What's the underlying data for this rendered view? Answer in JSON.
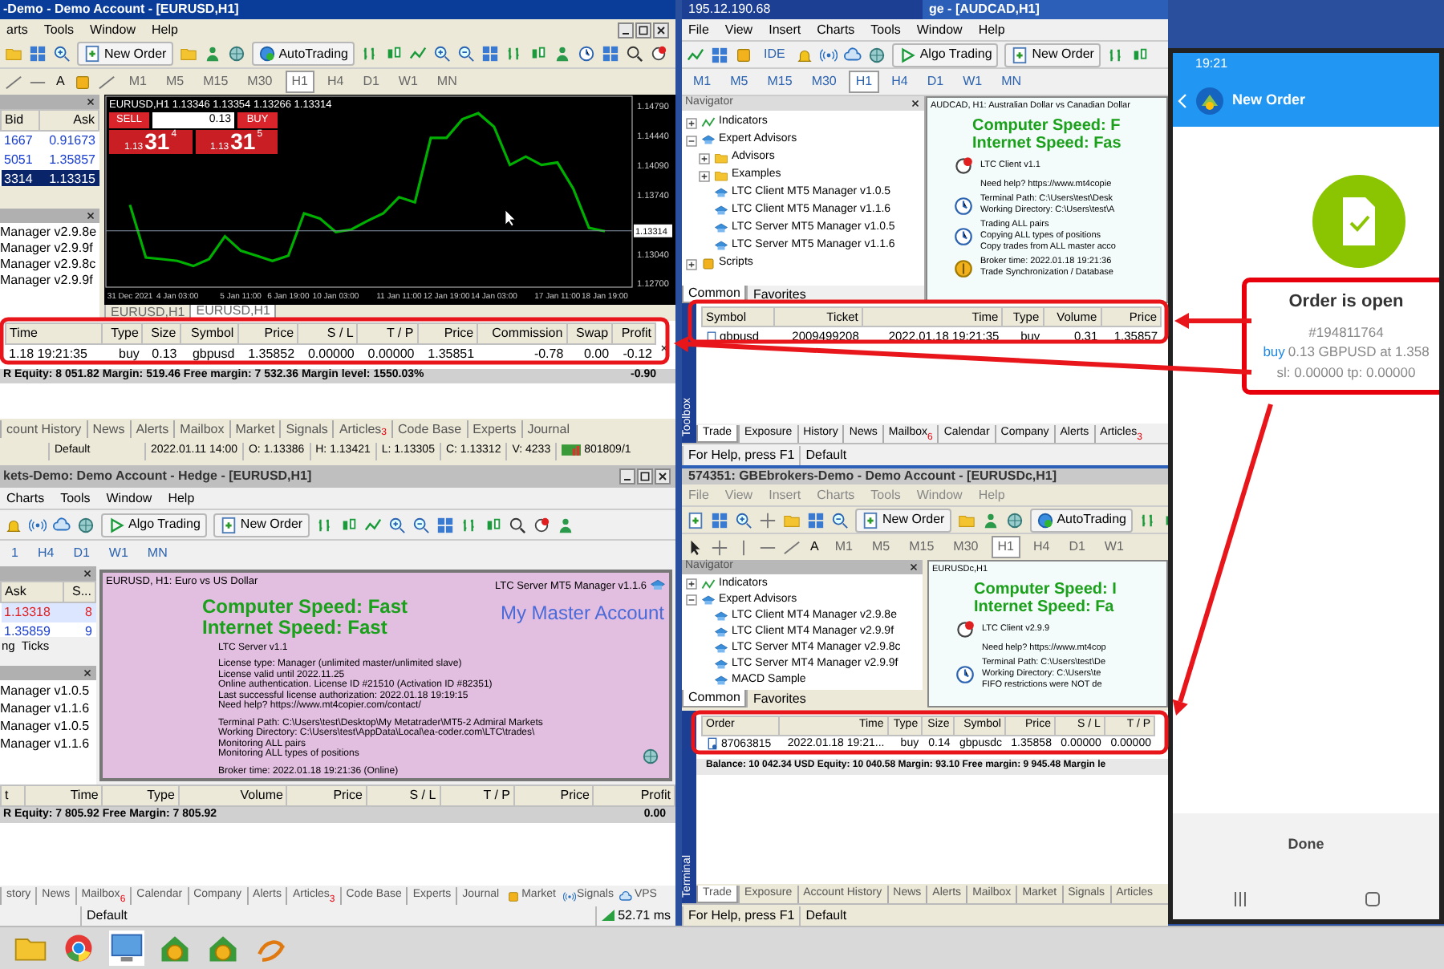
{
  "terminal_top_left": {
    "title": "-Demo - Demo Account - [EURUSD,H1]",
    "menu": [
      "arts",
      "Tools",
      "Window",
      "Help"
    ],
    "toolbar": [
      "New Order",
      "AutoTrading"
    ],
    "drawing_tools": [
      "A"
    ],
    "timeframes": [
      {
        "label": "M1",
        "selected": false
      },
      {
        "label": "M5",
        "selected": false
      },
      {
        "label": "M15",
        "selected": false
      },
      {
        "label": "M30",
        "selected": false
      },
      {
        "label": "H1",
        "selected": true
      },
      {
        "label": "H4",
        "selected": false
      },
      {
        "label": "D1",
        "selected": false
      },
      {
        "label": "W1",
        "selected": false
      },
      {
        "label": "MN",
        "selected": false
      }
    ],
    "market_watch": {
      "columns": [
        "Bid",
        "Ask"
      ],
      "rows": [
        {
          "cells": [
            "1667",
            "0.91673"
          ],
          "selected": false
        },
        {
          "cells": [
            "5051",
            "1.35857"
          ],
          "selected": false
        },
        {
          "cells": [
            "3314",
            "1.13315"
          ],
          "selected": true
        }
      ]
    },
    "navigator": [
      "Manager v2.9.8e",
      "Manager v2.9.9f",
      "Manager v2.9.8c",
      "Manager v2.9.9f"
    ],
    "chart": {
      "header": "EURUSD,H1  1.13346 1.13354 1.13266 1.13314",
      "one_click": {
        "sell_label": "SELL",
        "buy_label": "BUY",
        "lot": "0.13",
        "sell_prefix": "1.13",
        "sell_big": "31",
        "sell_sup": "4",
        "buy_prefix": "1.13",
        "buy_big": "31",
        "buy_sup": "5"
      },
      "current_price": "1.13314",
      "chart_data": {
        "type": "line",
        "categories": [
          "31 Dec 2021",
          null,
          null,
          "4 Jan 03:00",
          null,
          null,
          null,
          "5 Jan 11:00",
          null,
          null,
          "6 Jan 19:00",
          null,
          null,
          "10 Jan 03:00",
          null,
          null,
          null,
          "11 Jan 11:00",
          null,
          null,
          "12 Jan 19:00",
          null,
          null,
          "14 Jan 03:00",
          null,
          null,
          null,
          "17 Jan 11:00",
          null,
          null,
          "18 Jan 19:00"
        ],
        "series": [
          {
            "color": "#00b000",
            "values": [
              1.1362,
              1.13,
              1.1298,
              1.1296,
              1.129,
              1.1298,
              1.1325,
              1.1308,
              1.1302,
              1.1296,
              1.1302,
              1.1352,
              1.1346,
              1.133,
              1.1333,
              1.1343,
              1.1352,
              1.1371,
              1.1365,
              1.1441,
              1.1441,
              1.1463,
              1.147,
              1.1454,
              1.1409,
              1.1419,
              1.1409,
              1.1412,
              1.1381,
              1.1335,
              1.1331
            ]
          }
        ],
        "ylim": [
          1.1265,
          1.149
        ],
        "yticks": [
          {
            "value": 1.127,
            "label": "1.12700"
          },
          {
            "value": 1.1304,
            "label": "1.13040"
          },
          {
            "value": 1.1374,
            "label": "1.13740"
          },
          {
            "value": 1.1409,
            "label": "1.14090"
          },
          {
            "value": 1.1444,
            "label": "1.14440"
          },
          {
            "value": 1.1479,
            "label": "1.14790"
          }
        ]
      }
    },
    "chart_tabs": [
      {
        "label": "EURUSD,H1",
        "selected": false
      },
      {
        "label": "EURUSD,H1",
        "selected": true
      }
    ],
    "trade_table": {
      "columns": [
        "Time",
        "Type",
        "Size",
        "Symbol",
        "Price",
        "S / L",
        "T / P",
        "Price",
        "Commission",
        "Swap",
        "Profit"
      ],
      "rows": [
        [
          "1.18 19:21:35",
          "buy",
          "0.13",
          "gbpusd",
          "1.35852",
          "0.00000",
          "0.00000",
          "1.35851",
          "-0.78",
          "0.00",
          "-0.12"
        ]
      ]
    },
    "summary": {
      "text": "R  Equity: 8 051.82  Margin: 519.46  Free margin: 7 532.36  Margin level: 1550.03%",
      "total": "-0.90"
    },
    "bottom_tabs": [
      {
        "label": "count History",
        "selected": false
      },
      {
        "label": "News",
        "selected": false
      },
      {
        "label": "Alerts",
        "selected": false
      },
      {
        "label": "Mailbox",
        "selected": false
      },
      {
        "label": "Market",
        "selected": false
      },
      {
        "label": "Signals",
        "selected": false
      },
      {
        "label": "Articles",
        "badge": "3",
        "selected": false
      },
      {
        "label": "Code Base",
        "selected": false
      },
      {
        "label": "Experts",
        "selected": false
      },
      {
        "label": "Journal",
        "selected": false
      }
    ],
    "status_bar": [
      "Default",
      "2022.01.11 14:00",
      "O: 1.13386",
      "H: 1.13421",
      "L: 1.13305",
      "C: 1.13312",
      "V: 4233",
      "801809/1"
    ]
  },
  "terminal_top_right": {
    "address": "195.12.190.68",
    "title": "ge - [AUDCAD,H1]",
    "menu": [
      "File",
      "View",
      "Insert",
      "Charts",
      "Tools",
      "Window",
      "Help"
    ],
    "toolbar": [
      "IDE",
      "Algo Trading",
      "New Order"
    ],
    "timeframes": [
      {
        "label": "M1",
        "selected": false
      },
      {
        "label": "M5",
        "selected": false
      },
      {
        "label": "M15",
        "selected": false
      },
      {
        "label": "M30",
        "selected": false
      },
      {
        "label": "H1",
        "selected": true
      },
      {
        "label": "H4",
        "selected": false
      },
      {
        "label": "D1",
        "selected": false
      },
      {
        "label": "W1",
        "selected": false
      },
      {
        "label": "MN",
        "selected": false
      }
    ],
    "navigator": {
      "title": "Navigator",
      "items": [
        {
          "label": "Indicators",
          "kind": "indicators",
          "expanded": false
        },
        {
          "label": "Expert Advisors",
          "kind": "experts",
          "expanded": true,
          "children": [
            {
              "label": "Advisors",
              "kind": "folder",
              "expanded": false
            },
            {
              "label": "Examples",
              "kind": "folder",
              "expanded": false
            },
            {
              "label": "LTC Client MT5 Manager v1.0.5",
              "kind": "expert",
              "expanded": false
            },
            {
              "label": "LTC Client MT5 Manager v1.1.6",
              "kind": "expert",
              "expanded": false
            },
            {
              "label": "LTC Server MT5 Manager v1.0.5",
              "kind": "expert",
              "expanded": false
            },
            {
              "label": "LTC Server MT5 Manager v1.1.6",
              "kind": "expert",
              "expanded": false
            }
          ]
        },
        {
          "label": "Scripts",
          "kind": "scripts",
          "expanded": false
        }
      ],
      "tabs": [
        {
          "label": "Common",
          "selected": true
        },
        {
          "label": "Favorites",
          "selected": false
        }
      ]
    },
    "chart": {
      "header": "AUDCAD, H1:  Australian Dollar vs Canadian Dollar",
      "speed": [
        "Computer Speed: F",
        "Internet Speed: Fas"
      ],
      "blocks": [
        [
          "LTC Client v1.1"
        ],
        [
          "Need help? https://www.mt4copie"
        ],
        [
          "Terminal Path: C:\\Users\\test\\Desk",
          "Working Directory: C:\\Users\\test\\A"
        ],
        [
          "Trading ALL pairs",
          "Copying ALL types of positions",
          "Copy trades from ALL master acco"
        ],
        [
          "Broker time: 2022.01.18 19:21:36",
          "Trade Synchronization / Database"
        ]
      ]
    },
    "side_label": "Toolbox",
    "trade_table": {
      "columns": [
        "Symbol",
        "Ticket",
        "Time",
        "Type",
        "Volume",
        "Price"
      ],
      "rows": [
        [
          "gbpusd",
          "2009499208",
          "2022.01.18 19:21:35",
          "buy",
          "0.31",
          "1.35857"
        ]
      ]
    },
    "bottom_tabs": [
      {
        "label": "Trade",
        "selected": true
      },
      {
        "label": "Exposure",
        "selected": false
      },
      {
        "label": "History",
        "selected": false
      },
      {
        "label": "News",
        "selected": false
      },
      {
        "label": "Mailbox",
        "badge": "6",
        "selected": false
      },
      {
        "label": "Calendar",
        "selected": false
      },
      {
        "label": "Company",
        "selected": false
      },
      {
        "label": "Alerts",
        "selected": false
      },
      {
        "label": "Articles",
        "badge": "3",
        "selected": false
      }
    ],
    "status_bar": [
      "For Help, press F1",
      "Default"
    ]
  },
  "terminal_bottom_left": {
    "title": "kets-Demo: Demo Account - Hedge - [EURUSD,H1]",
    "menu": [
      "Charts",
      "Tools",
      "Window",
      "Help"
    ],
    "toolbar": [
      "Algo Trading",
      "New Order"
    ],
    "timeframes": [
      {
        "label": "1",
        "selected": false
      },
      {
        "label": "H4",
        "selected": false
      },
      {
        "label": "D1",
        "selected": false
      },
      {
        "label": "W1",
        "selected": false
      },
      {
        "label": "MN",
        "selected": false
      }
    ],
    "market_watch": {
      "columns": [
        "Ask",
        "S..."
      ],
      "rows": [
        {
          "cells": [
            "1.13318",
            "8"
          ],
          "selected": true
        },
        {
          "cells": [
            "1.35859",
            "9"
          ],
          "selected": false
        }
      ],
      "tabs": [
        "ng",
        "Ticks"
      ]
    },
    "navigator": [
      "Manager v1.0.5",
      "Manager v1.1.6",
      "Manager v1.0.5",
      "Manager v1.1.6"
    ],
    "chart": {
      "header": "EURUSD, H1:  Euro vs US Dollar",
      "expert": "LTC Server MT5 Manager v1.1.6",
      "speed": [
        "Computer Speed: Fast",
        "Internet Speed: Fast"
      ],
      "account": "My Master Account",
      "blocks": [
        [
          "LTC Server v1.1"
        ],
        [
          "License type: Manager (unlimited master/unlimited slave)",
          "License valid until 2022.11.25",
          "Online authentication. License ID #21510 (Activation ID #82351)",
          "Last successful license authorization: 2022.01.18 19:19:15",
          "Need help? https://www.mt4copier.com/contact/"
        ],
        [
          "Terminal Path: C:\\Users\\test\\Desktop\\My Metatrader\\MT5-2 Admiral Markets",
          "Working Directory: C:\\Users\\test\\AppData\\Local\\ea-coder.com\\LTC\\trades\\",
          "Monitoring ALL pairs",
          "Monitoring ALL types of positions"
        ],
        [
          "Broker time: 2022.01.18 19:21:36 (Online)"
        ]
      ]
    },
    "trade_table": {
      "columns": [
        "t",
        "Time",
        "Type",
        "Volume",
        "Price",
        "S / L",
        "T / P",
        "Price",
        "Profit"
      ]
    },
    "summary": {
      "text": "R  Equity: 7 805.92  Free Margin: 7 805.92",
      "total": "0.00"
    },
    "bottom_tabs": [
      {
        "label": "story",
        "selected": false
      },
      {
        "label": "News",
        "selected": false
      },
      {
        "label": "Mailbox",
        "badge": "6",
        "selected": false
      },
      {
        "label": "Calendar",
        "selected": false
      },
      {
        "label": "Company",
        "selected": false
      },
      {
        "label": "Alerts",
        "selected": false
      },
      {
        "label": "Articles",
        "badge": "3",
        "selected": false
      },
      {
        "label": "Code Base",
        "selected": false
      },
      {
        "label": "Experts",
        "selected": false
      },
      {
        "label": "Journal",
        "selected": false
      }
    ],
    "services": [
      "Market",
      "Signals",
      "VPS"
    ],
    "status_bar": [
      "Default",
      "52.71 ms"
    ]
  },
  "terminal_bottom_right": {
    "title": "574351: GBEbrokers-Demo - Demo Account - [EURUSDc,H1]",
    "menu": [
      "File",
      "View",
      "Insert",
      "Charts",
      "Tools",
      "Window",
      "Help"
    ],
    "toolbar": [
      "New Order",
      "AutoTrading"
    ],
    "drawing_tools": [
      "A"
    ],
    "timeframes": [
      {
        "label": "M1",
        "selected": false
      },
      {
        "label": "M5",
        "selected": false
      },
      {
        "label": "M15",
        "selected": false
      },
      {
        "label": "M30",
        "selected": false
      },
      {
        "label": "H1",
        "selected": true
      },
      {
        "label": "H4",
        "selected": false
      },
      {
        "label": "D1",
        "selected": false
      },
      {
        "label": "W1",
        "selected": false
      }
    ],
    "navigator": {
      "title": "Navigator",
      "items": [
        {
          "label": "Indicators",
          "kind": "indicators",
          "expanded": false
        },
        {
          "label": "Expert Advisors",
          "kind": "experts",
          "expanded": true,
          "children": [
            {
              "label": "LTC Client MT4 Manager v2.9.8e",
              "kind": "expert",
              "expanded": false
            },
            {
              "label": "LTC Client MT4 Manager v2.9.9f",
              "kind": "expert",
              "expanded": false
            },
            {
              "label": "LTC Server MT4 Manager v2.9.8c",
              "kind": "expert",
              "expanded": false
            },
            {
              "label": "LTC Server MT4 Manager v2.9.9f",
              "kind": "expert",
              "expanded": false
            },
            {
              "label": "MACD Sample",
              "kind": "expert",
              "expanded": false
            }
          ]
        }
      ],
      "tabs": [
        {
          "label": "Common",
          "selected": true
        },
        {
          "label": "Favorites",
          "selected": false
        }
      ]
    },
    "chart": {
      "header": "EURUSDc,H1",
      "speed": [
        "Computer Speed: I",
        "Internet Speed: Fa"
      ],
      "blocks": [
        [
          "LTC Client v2.9.9"
        ],
        [
          "Need help? https://www.mt4cop"
        ],
        [
          "Terminal Path: C:\\Users\\test\\De",
          "Working Directory: C:\\Users\\te",
          "FIFO restrictions were NOT de"
        ]
      ]
    },
    "side_label": "Terminal",
    "trade_table": {
      "columns": [
        "Order",
        "Time",
        "Type",
        "Size",
        "Symbol",
        "Price",
        "S / L",
        "T / P"
      ],
      "rows": [
        [
          "87063815",
          "2022.01.18 19:21...",
          "buy",
          "0.14",
          "gbpusdc",
          "1.35858",
          "0.00000",
          "0.00000"
        ]
      ]
    },
    "summary": {
      "text": "Balance: 10 042.34 USD  Equity: 10 040.58  Margin: 93.10  Free margin: 9 945.48  Margin le"
    },
    "bottom_tabs": [
      {
        "label": "Trade",
        "selected": true
      },
      {
        "label": "Exposure",
        "selected": false
      },
      {
        "label": "Account History",
        "selected": false
      },
      {
        "label": "News",
        "selected": false
      },
      {
        "label": "Alerts",
        "selected": false
      },
      {
        "label": "Mailbox",
        "selected": false
      },
      {
        "label": "Market",
        "selected": false
      },
      {
        "label": "Signals",
        "selected": false
      },
      {
        "label": "Articles",
        "selected": false
      }
    ],
    "status_bar": [
      "For Help, press F1",
      "Default"
    ]
  },
  "phone": {
    "time": "19:21",
    "header_title": "New Order",
    "result_title": "Order is open",
    "ticket": "#194811764",
    "side": "buy",
    "detail": "0.13 GBPUSD at 1.358",
    "stops": "sl: 0.00000 tp: 0.00000",
    "done_button": "Done"
  }
}
